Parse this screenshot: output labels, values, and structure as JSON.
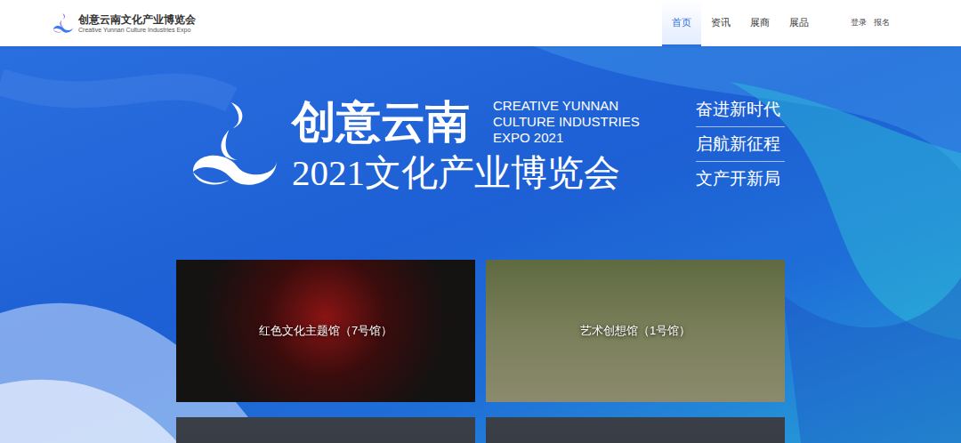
{
  "header": {
    "brand": {
      "name": "创意云南文化产业博览会",
      "subtitle": "Creative Yunnan Culture Industries Expo"
    },
    "nav": [
      {
        "label": "首页",
        "selected": true
      },
      {
        "label": "资讯",
        "selected": false
      },
      {
        "label": "展商",
        "selected": false
      },
      {
        "label": "展品",
        "selected": false
      }
    ],
    "account": [
      "登录",
      "报名"
    ]
  },
  "banner": {
    "title": "创意云南",
    "english": [
      "CREATIVE YUNNAN",
      "CULTURE INDUSTRIES",
      "EXPO 2021"
    ],
    "subtitle": "2021文化产业博览会",
    "slogans": [
      "奋进新时代",
      "启航新征程",
      "文产开新局"
    ]
  },
  "halls": [
    {
      "kind": "labeled",
      "label": "红色文化主题馆（7号馆）",
      "photo": "red"
    },
    {
      "kind": "labeled",
      "label": "艺术创想馆（1号馆）",
      "photo": "green"
    },
    {
      "kind": "plain",
      "photo": "dark"
    },
    {
      "kind": "plain",
      "photo": "dark"
    }
  ]
}
